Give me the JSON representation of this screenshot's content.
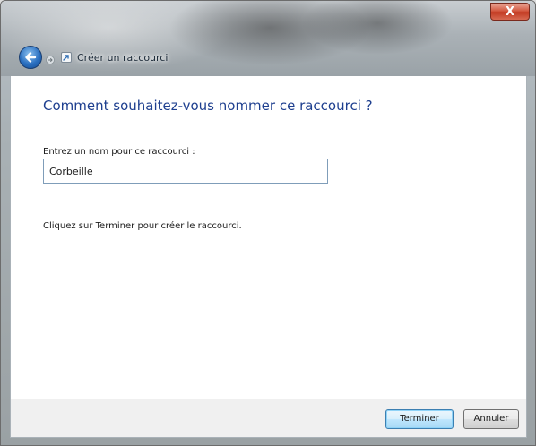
{
  "window": {
    "close_label": "X"
  },
  "navigation": {
    "breadcrumb": "Créer un raccourci",
    "back_icon": "back-arrow-icon",
    "forward_icon": "forward-arrow-icon"
  },
  "main": {
    "heading": "Comment souhaitez-vous nommer ce raccourci ?",
    "name_label": "Entrez un nom pour ce raccourci :",
    "name_value": "Corbeille",
    "instruction": "Cliquez sur Terminer pour créer le raccourci."
  },
  "footer": {
    "finish_label": "Terminer",
    "cancel_label": "Annuler"
  },
  "colors": {
    "heading": "#1e3f8f",
    "finish_button_border": "#3c7fb1",
    "close_button": "#c23a22"
  }
}
